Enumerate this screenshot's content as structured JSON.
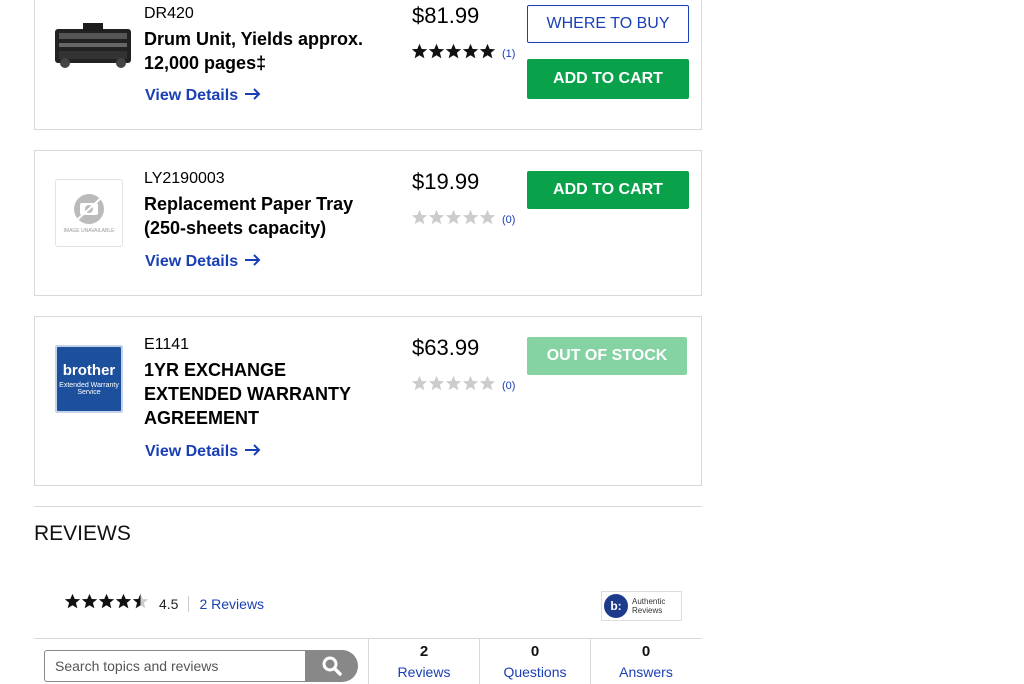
{
  "products": [
    {
      "sku": "DR420",
      "name": "Drum Unit, Yields approx. 12,000 pages‡",
      "details_label": "View Details",
      "price": "$81.99",
      "rating": 5,
      "rating_count": "(1)",
      "where_to_buy_label": "WHERE TO BUY",
      "cart_label": "ADD TO CART",
      "thumb_icon": "drum-unit-image"
    },
    {
      "sku": "LY2190003",
      "name": "Replacement Paper Tray (250-sheets capacity)",
      "details_label": "View Details",
      "price": "$19.99",
      "rating": 0,
      "rating_count": "(0)",
      "cart_label": "ADD TO CART",
      "thumb_icon": "image-unavailable",
      "thumb_text": "IMAGE UNAVAILABLE"
    },
    {
      "sku": "E1141",
      "name": "1YR EXCHANGE EXTENDED WARRANTY AGREEMENT",
      "details_label": "View Details",
      "price": "$63.99",
      "rating": 0,
      "rating_count": "(0)",
      "cart_label": "OUT OF STOCK",
      "thumb_icon": "brother-warranty-logo",
      "thumb_brand": "brother",
      "thumb_sub1": "Extended Warranty",
      "thumb_sub2": "Service"
    }
  ],
  "reviews": {
    "title": "REVIEWS",
    "average": "4.5",
    "average_rating": 4.5,
    "count_link": "2 Reviews",
    "authentic_line1": "Authentic",
    "authentic_line2": "Reviews",
    "search_placeholder": "Search topics and reviews",
    "tabs": [
      {
        "count": "2",
        "label": "Reviews"
      },
      {
        "count": "0",
        "label": "Questions"
      },
      {
        "count": "0",
        "label": "Answers"
      }
    ]
  },
  "colors": {
    "green": "#0aa14b",
    "green_disabled": "#85d2a3",
    "link_blue": "#1a3fb5",
    "star_filled": "#111111",
    "star_empty": "#cccccc"
  }
}
